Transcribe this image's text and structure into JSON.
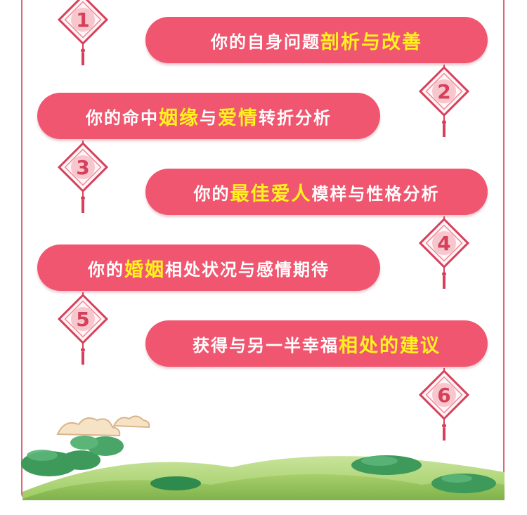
{
  "items": [
    {
      "num": "1",
      "parts": [
        {
          "t": "你的自身问题",
          "h": false
        },
        {
          "t": "剖析与改善",
          "h": true
        }
      ]
    },
    {
      "num": "2",
      "parts": [
        {
          "t": "你的命中",
          "h": false
        },
        {
          "t": "姻缘",
          "h": true
        },
        {
          "t": "与",
          "h": false
        },
        {
          "t": "爱情",
          "h": true
        },
        {
          "t": "转折分析",
          "h": false
        }
      ]
    },
    {
      "num": "3",
      "parts": [
        {
          "t": "你的",
          "h": false
        },
        {
          "t": "最佳爱人",
          "h": true
        },
        {
          "t": "模样与性格分析",
          "h": false
        }
      ]
    },
    {
      "num": "4",
      "parts": [
        {
          "t": "你的",
          "h": false
        },
        {
          "t": "婚姻",
          "h": true
        },
        {
          "t": "相处状况与感情期待",
          "h": false
        }
      ]
    },
    {
      "num": "5",
      "parts": [
        {
          "t": "获得与另一半幸福",
          "h": false
        },
        {
          "t": "相处的建议",
          "h": true
        }
      ]
    },
    {
      "num": "6",
      "parts": []
    }
  ],
  "colors": {
    "pill": "#f0566f",
    "highlight": "#fff21d",
    "frame": "#e2637a",
    "knot": "#d6405a"
  }
}
